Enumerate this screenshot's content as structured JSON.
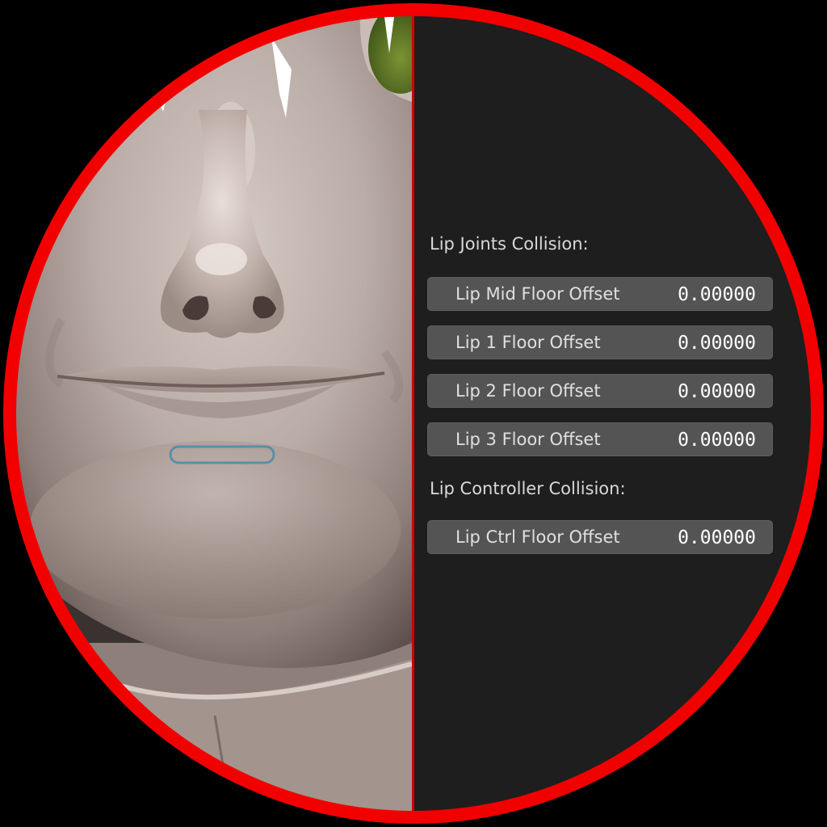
{
  "panel": {
    "sections": [
      {
        "heading": "Lip Joints Collision:",
        "properties": [
          {
            "name": "Lip Mid Floor Offset",
            "value": "0.00000"
          },
          {
            "name": "Lip 1 Floor Offset",
            "value": "0.00000"
          },
          {
            "name": "Lip 2 Floor Offset",
            "value": "0.00000"
          },
          {
            "name": "Lip 3 Floor Offset",
            "value": "0.00000"
          }
        ]
      },
      {
        "heading": "Lip Controller Collision:",
        "properties": [
          {
            "name": "Lip Ctrl Floor Offset",
            "value": "0.00000"
          }
        ]
      }
    ]
  },
  "viewport": {
    "selected_control": "lip-controller",
    "colors": {
      "skin": "#b8aaa4",
      "controller_outline": "#5a8fa8",
      "eye_iris": "#5f7a2a"
    }
  },
  "colors": {
    "ring": "#f20000",
    "divider": "#d10000",
    "panel_bg": "#1e1e1e",
    "field_bg": "#545454",
    "text": "#e0e0e0"
  }
}
